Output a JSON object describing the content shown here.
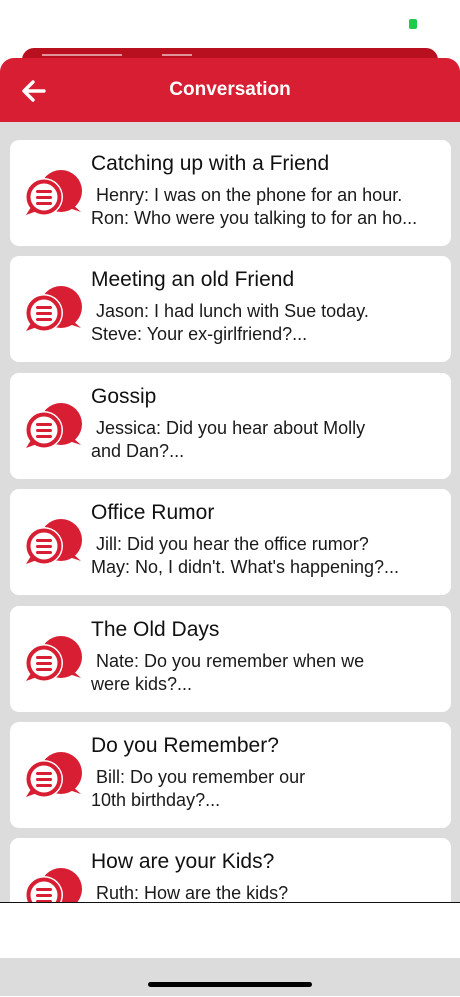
{
  "header": {
    "title": "Conversation"
  },
  "colors": {
    "accent": "#d71e32",
    "background": "#dcdcdc",
    "card": "#ffffff"
  },
  "conversations": [
    {
      "title": "Catching up with a Friend",
      "preview": " Henry: I was on the phone for an hour.\nRon: Who were you talking to for an ho..."
    },
    {
      "title": "Meeting an old Friend",
      "preview": " Jason: I had lunch with Sue today.\nSteve: Your ex-girlfriend?..."
    },
    {
      "title": "Gossip",
      "preview": " Jessica: Did you hear about Molly\nand Dan?..."
    },
    {
      "title": "Office Rumor",
      "preview": " Jill: Did you hear the office rumor?\nMay: No, I didn't. What's happening?..."
    },
    {
      "title": "The Old Days",
      "preview": " Nate: Do you remember when we\nwere kids?..."
    },
    {
      "title": "Do you Remember?",
      "preview": " Bill: Do you remember our\n10th birthday?..."
    },
    {
      "title": "How are your Kids?",
      "preview": " Ruth: How are the kids?"
    }
  ],
  "icons": {
    "back": "arrow-left-icon",
    "conversation": "chat-bubbles-icon"
  }
}
